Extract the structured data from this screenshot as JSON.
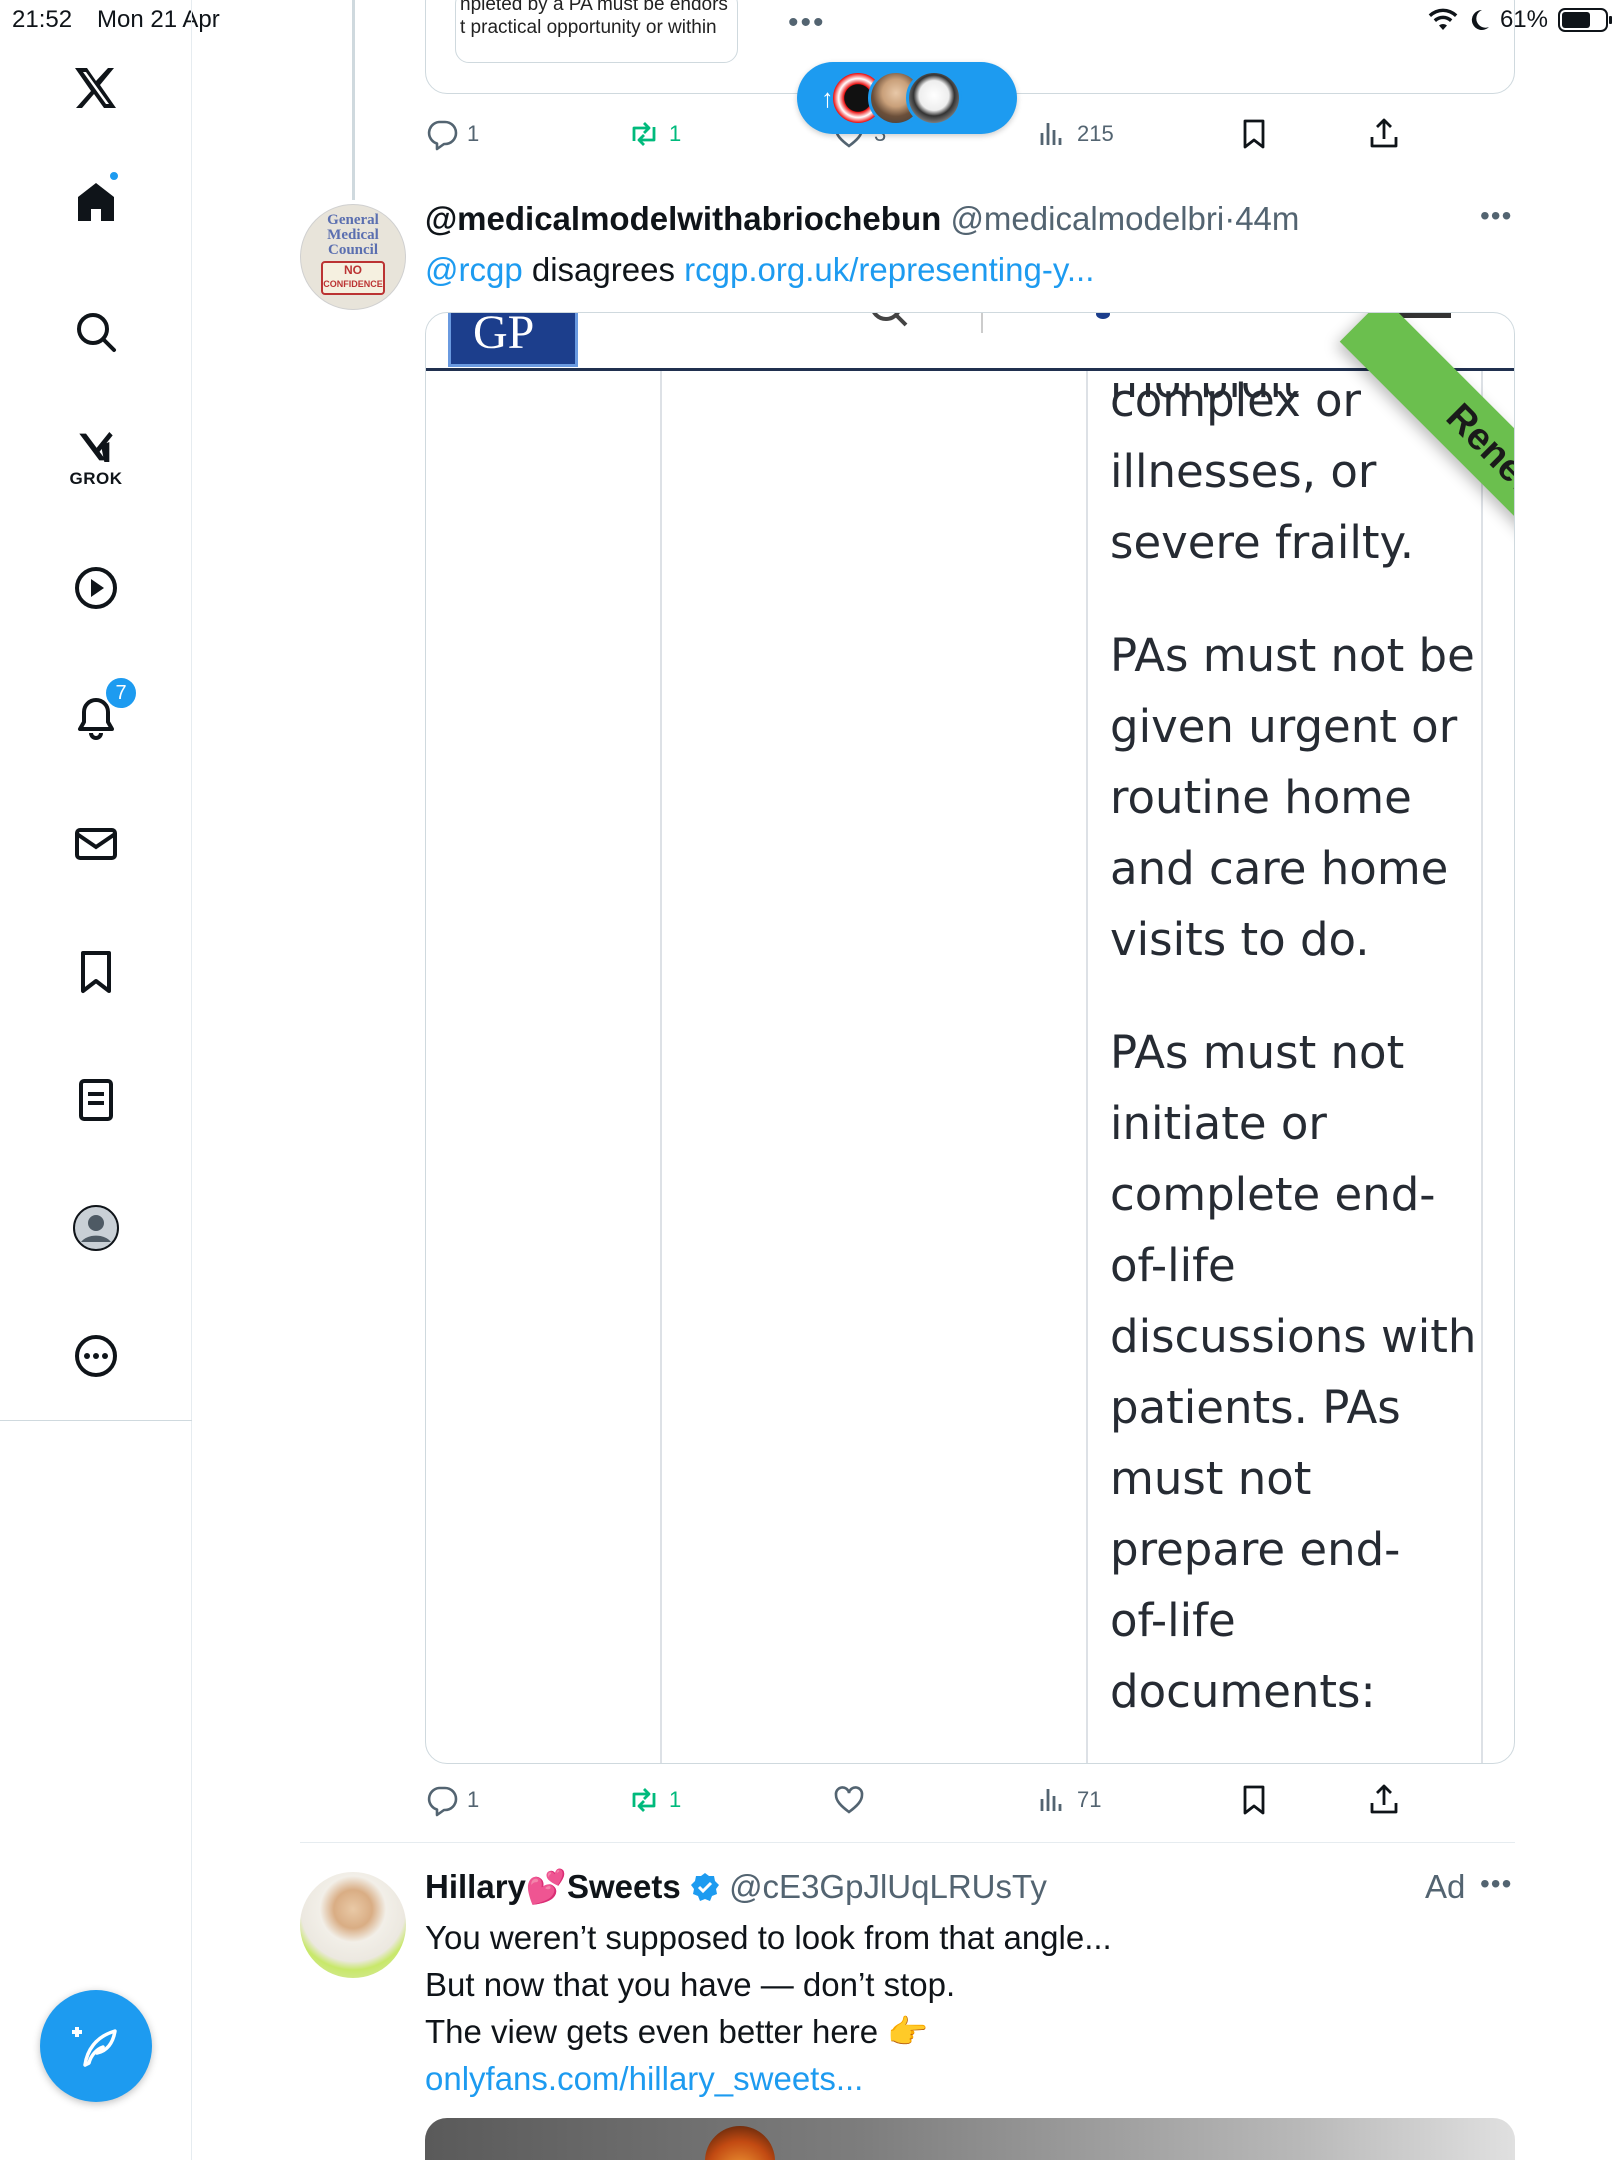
{
  "status_bar": {
    "time": "21:52",
    "date": "Mon 21 Apr",
    "battery": "61%"
  },
  "sidebar": {
    "grok_label": "GROK",
    "notifications_badge": "7"
  },
  "quoted_top": {
    "line1": "npleted by a PA must be endors",
    "line2": "t practical opportunity or within",
    "more": "•••"
  },
  "new_posts_pill": {
    "arrow": "↑"
  },
  "top_actions": {
    "replies": "1",
    "reposts": "1",
    "likes": "3",
    "views": "215"
  },
  "tweet1": {
    "name": "@medicalmodelwithabriochebun",
    "handle": "@medicalmodelbri",
    "separator": "·",
    "time": "44m",
    "mention": "@rcgp",
    "text": " disagrees ",
    "link": "rcgp.org.uk/representing-y...",
    "avatar_text": [
      "General",
      "Medical",
      "Council",
      "NO",
      "CONFIDENCE"
    ],
    "image": {
      "logo": "GP",
      "banner": "Renew",
      "lines": [
        "complex or",
        "illnesses, or",
        "severe frailty.",
        "PAs must not be",
        "given urgent or",
        "routine home",
        "and care home",
        "visits to do.",
        "PAs must not",
        "initiate or",
        "complete end-",
        "of-life",
        "discussions with",
        "patients. PAs",
        "must not",
        "prepare end-",
        "of-life",
        "documents:"
      ],
      "clipped_top_line": "morbidit"
    },
    "actions": {
      "replies": "1",
      "reposts": "1",
      "views": "71"
    }
  },
  "tweet2": {
    "name_part1": "Hillary",
    "emoji": "💕",
    "name_part2": "Sweets",
    "handle": "@cE3GpJlUqLRUsTy",
    "ad_label": "Ad",
    "lines": [
      "You weren’t supposed to look from that angle...",
      "But now that you have — don’t stop.",
      "The view gets even better here 👉"
    ],
    "link": "onlyfans.com/hillary_sweets..."
  },
  "colors": {
    "accent": "#1d9bf0",
    "repost_green": "#00ba7c",
    "secondary_text": "#536471",
    "renew_green": "#6bbf4e"
  }
}
